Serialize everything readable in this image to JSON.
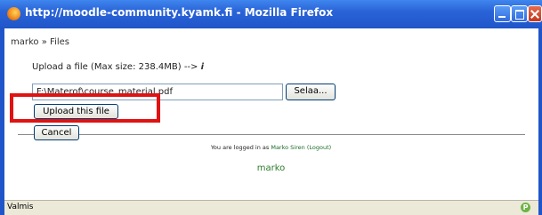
{
  "window": {
    "title": "http://moodle-community.kyamk.fi - Mozilla Firefox"
  },
  "breadcrumb": {
    "home": "marko",
    "separator": "»",
    "current": "Files"
  },
  "upload": {
    "label": "Upload a file (Max size: 238.4MB) -->",
    "help_symbol": "i",
    "file_value": "F:\\Materof\\course_material.pdf",
    "browse_label": "Selaa...",
    "submit_label": "Upload this file",
    "cancel_label": "Cancel"
  },
  "footer": {
    "login_prefix": "You are logged in as",
    "user_name": "Marko Siren",
    "logout_label": "(Logout)",
    "user_link": "marko"
  },
  "status": {
    "text": "Valmis",
    "icon": "p-icon"
  },
  "colors": {
    "titlebar": "#2a63d8",
    "highlight": "#e01212",
    "link_green": "#2a7a2a"
  }
}
